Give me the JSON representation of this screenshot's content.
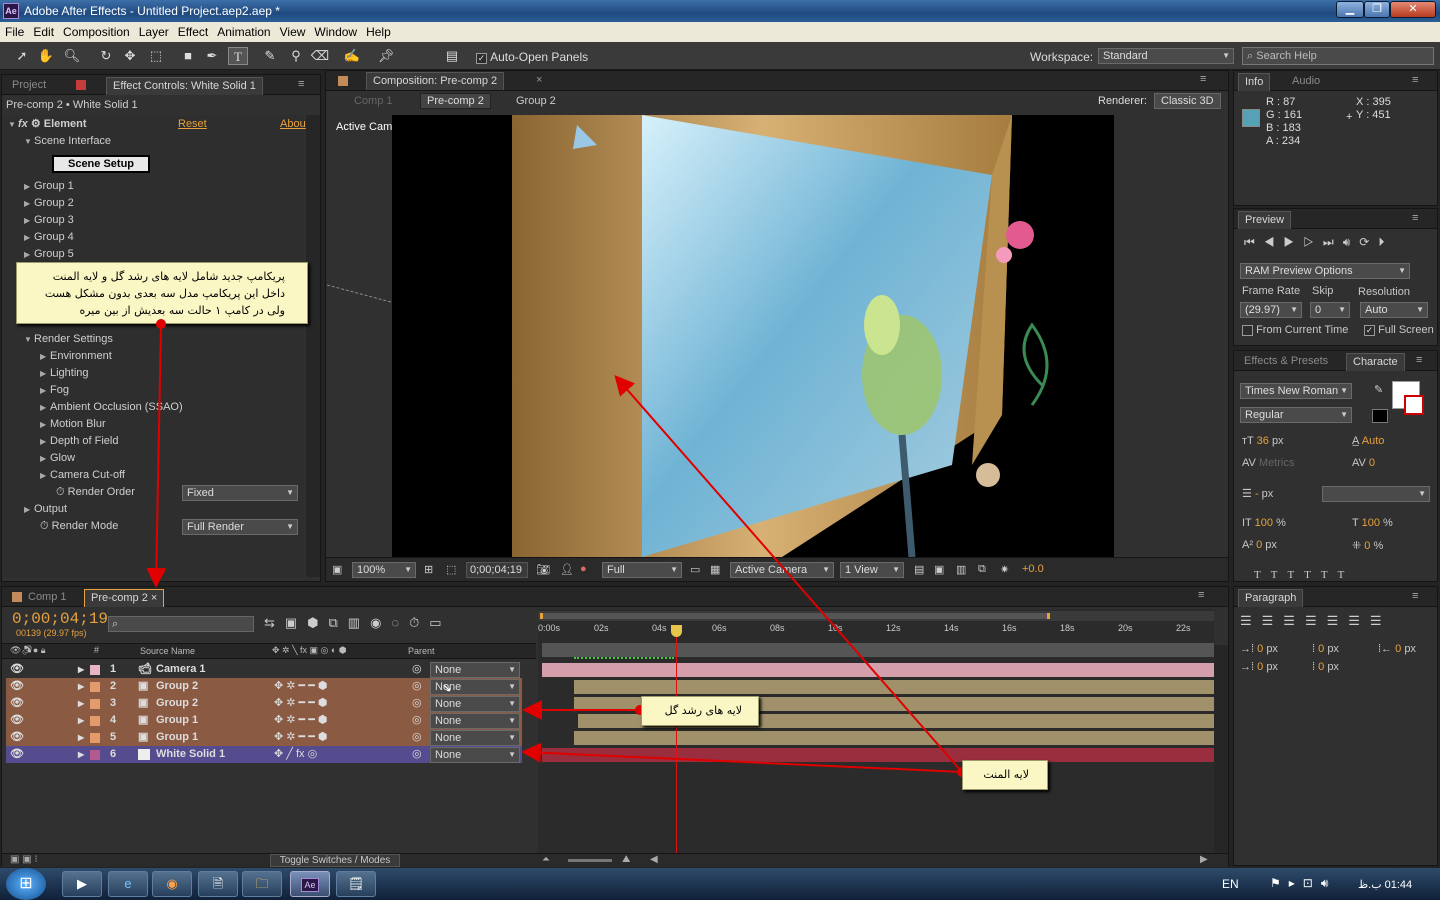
{
  "window": {
    "title": "Adobe After Effects - Untitled Project.aep2.aep *",
    "app_icon": "Ae",
    "controls": {
      "min": "▁",
      "max": "❐",
      "close": "✕"
    }
  },
  "menu": [
    "File",
    "Edit",
    "Composition",
    "Layer",
    "Effect",
    "Animation",
    "View",
    "Window",
    "Help"
  ],
  "toolbar": {
    "auto_open_label": "Auto-Open Panels",
    "auto_open_checked": true,
    "workspace_label": "Workspace:",
    "workspace_value": "Standard",
    "search_placeholder": "Search Help"
  },
  "effect_panel": {
    "tabs": [
      "Project",
      "Effect Controls: White Solid 1"
    ],
    "breadcrumb": "Pre-comp 2 • White Solid 1",
    "effect_name": "Element",
    "reset": "Reset",
    "about": "Abou",
    "scene_interface": "Scene Interface",
    "scene_setup": "Scene Setup",
    "groups": [
      "Group 1",
      "Group 2",
      "Group 3",
      "Group 4",
      "Group 5"
    ],
    "render_settings": "Render Settings",
    "render_items": [
      "Environment",
      "Lighting",
      "Fog",
      "Ambient Occlusion (SSAO)",
      "Motion Blur",
      "Depth of Field",
      "Glow",
      "Camera Cut-off"
    ],
    "render_order_label": "Render Order",
    "render_order_value": "Fixed",
    "output": "Output",
    "render_mode_label": "Render Mode",
    "render_mode_value": "Full Render"
  },
  "callouts": {
    "top": [
      "پریکامپ جدید شامل لایه های رشد گل و لایه المنت",
      "داخل این پریکامپ مدل سه بعدی بدون مشکل هست",
      "ولی در کامپ ۱ حالت سه بعدیش از بین میره"
    ],
    "growth": "لایه های رشد گل",
    "element": "لایه المنت"
  },
  "composition": {
    "tab": "Composition: Pre-comp 2",
    "nav": [
      "Comp 1",
      "Pre-comp 2",
      "Group 2"
    ],
    "renderer_label": "Renderer:",
    "renderer_value": "Classic 3D",
    "viewer_label": "Active Camera",
    "zoom": "100%",
    "timecode": "0;00;04;19",
    "resolution": "Full",
    "camera": "Active Camera",
    "views": "1 View",
    "exposure": "+0.0"
  },
  "info": {
    "tabs": [
      "Info",
      "Audio"
    ],
    "r": "R : 87",
    "g": "G : 161",
    "b": "B : 183",
    "a": "A : 234",
    "x": "X : 395",
    "y": "Y : 451",
    "swatch": "#57a1b7"
  },
  "preview": {
    "tab": "Preview",
    "ram": "RAM Preview Options",
    "frame_rate_label": "Frame Rate",
    "skip_label": "Skip",
    "resolution_label": "Resolution",
    "frame_rate": "(29.97)",
    "skip": "0",
    "resolution": "Auto",
    "from_current": "From Current Time",
    "full_screen": "Full Screen"
  },
  "character": {
    "tabs": [
      "Effects & Presets",
      "Characte"
    ],
    "font": "Times New Roman",
    "style": "Regular",
    "size": "36",
    "size_unit": "px",
    "leading": "Auto",
    "kerning": "Metrics",
    "tracking": "0",
    "stroke": "-",
    "stroke_unit": "px",
    "vscale": "100",
    "hscale": "100",
    "pct": "%",
    "baseline": "0",
    "baseline_unit": "px",
    "tsume": "0"
  },
  "paragraph": {
    "tab": "Paragraph",
    "values": [
      "0",
      "0",
      "0",
      "0",
      "0"
    ],
    "unit": "px"
  },
  "timeline": {
    "tabs": [
      "Comp 1",
      "Pre-comp 2"
    ],
    "timecode": "0;00;04;19",
    "frame_info": "00139 (29.97 fps)",
    "search_placeholder": "",
    "col_source": "Source Name",
    "col_parent": "Parent",
    "ruler": [
      "0:00s",
      "02s",
      "04s",
      "06s",
      "08s",
      "10s",
      "12s",
      "14s",
      "16s",
      "18s",
      "20s",
      "22s"
    ],
    "layers": [
      {
        "num": "1",
        "name": "Camera 1",
        "parent": "None",
        "kind": "camera",
        "color": "#e8b4c6"
      },
      {
        "num": "2",
        "name": "Group 2",
        "parent": "None",
        "kind": "comp",
        "color": "#e39b6b"
      },
      {
        "num": "3",
        "name": "Group 2",
        "parent": "None",
        "kind": "comp",
        "color": "#e39b6b"
      },
      {
        "num": "4",
        "name": "Group 1",
        "parent": "None",
        "kind": "comp",
        "color": "#e39b6b"
      },
      {
        "num": "5",
        "name": "Group 1",
        "parent": "None",
        "kind": "comp",
        "color": "#e39b6b"
      },
      {
        "num": "6",
        "name": "White Solid 1",
        "parent": "None",
        "kind": "solid",
        "color": "#b35a8f"
      }
    ],
    "toggle_label": "Toggle Switches / Modes"
  },
  "taskbar": {
    "lang": "EN",
    "time": "01:44 ب.ظ"
  },
  "colors": {
    "accent": "#e7a23e",
    "arrow": "#e00000"
  }
}
